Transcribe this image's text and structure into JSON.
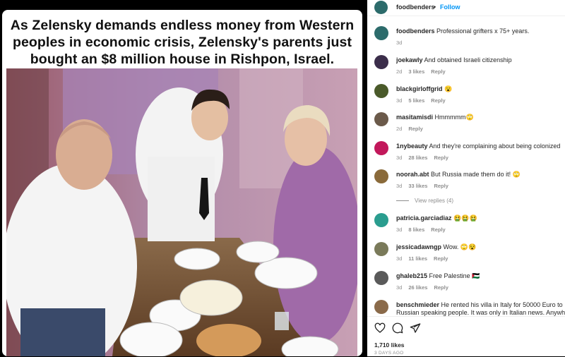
{
  "post": {
    "headline_lines": [
      "As Zelensky demands endless money from Western",
      "peoples in economic crisis, Zelensky's parents just",
      "bought an $8 million house in Rishpon, Israel."
    ]
  },
  "header": {
    "username": "foodbenders",
    "separator": "•",
    "follow_label": "Follow"
  },
  "caption": {
    "username": "foodbenders",
    "text": "Professional grifters x 75+ years.",
    "age": "3d"
  },
  "comments": [
    {
      "username": "joekawly",
      "text": "And obtained Israeli citizenship",
      "age": "2d",
      "likes": "3 likes",
      "reply": "Reply",
      "avatar_color": "#3b2d4a"
    },
    {
      "username": "blackgirloffgrid",
      "text": "😮",
      "age": "3d",
      "likes": "5 likes",
      "reply": "Reply",
      "avatar_color": "#4a5a2a"
    },
    {
      "username": "masitamisdi",
      "text": "Hmmmmm🙄",
      "age": "2d",
      "likes": "",
      "reply": "Reply",
      "avatar_color": "#6b5a4a"
    },
    {
      "username": "1nybeauty",
      "text": "And they're complaining about being colonized",
      "age": "3d",
      "likes": "28 likes",
      "reply": "Reply",
      "avatar_color": "#c2185b"
    },
    {
      "username": "noorah.abt",
      "text": "But Russia made them do it! 🙄",
      "age": "3d",
      "likes": "33 likes",
      "reply": "Reply",
      "avatar_color": "#8a6a3a"
    },
    {
      "username": "patricia.garciadiaz",
      "text": "🤮🤮🤮",
      "age": "3d",
      "likes": "8 likes",
      "reply": "Reply",
      "avatar_color": "#2a9d8f"
    },
    {
      "username": "jessicadawngp",
      "text": "Wow. 🙄😵",
      "age": "3d",
      "likes": "11 likes",
      "reply": "Reply",
      "avatar_color": "#7a7a5a"
    },
    {
      "username": "ghaleb215",
      "text": "Free Palestine 🇵🇸",
      "age": "3d",
      "likes": "26 likes",
      "reply": "Reply",
      "avatar_color": "#5a5a5a"
    },
    {
      "username": "benschmieder",
      "text": "He rented his villa in Italy for 50000 Euro to",
      "text2": "Russian speaking people. It was only in Italian news. Anywhere",
      "avatar_color": "#8a6a4a"
    }
  ],
  "view_replies": "View replies (4)",
  "footer": {
    "likes": "1,710 likes",
    "ago": "3 DAYS AGO"
  }
}
